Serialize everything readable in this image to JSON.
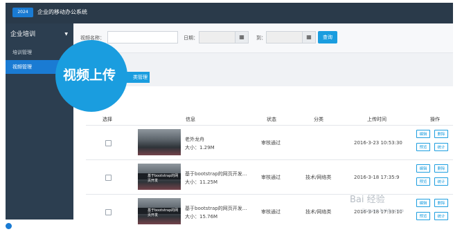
{
  "header": {
    "logo": "2024",
    "title": "企业的移动办公系统"
  },
  "sidebar": {
    "section": "企业培训",
    "items": [
      {
        "label": "培训管理"
      },
      {
        "label": "视频管理"
      }
    ]
  },
  "filter": {
    "name_label": "视频名称：",
    "date_label": "日期：",
    "to_label": "到：",
    "query": "查询"
  },
  "category_button": "类管理",
  "highlight": "视频上传",
  "table": {
    "headers": [
      "选择",
      "信息",
      "状态",
      "分类",
      "上传时间",
      "操作"
    ],
    "rows": [
      {
        "title": "老外龙舟",
        "size": "大小：1.29M",
        "caption": "",
        "status": "审核通过",
        "category": "",
        "time": "2016-3-23 10:53:30"
      },
      {
        "title": "基于bootstrap的网页开发...",
        "size": "大小：11.25M",
        "caption": "基于bootstrap的网页开发",
        "status": "审核通过",
        "category": "技术/网络类",
        "time": "2016-3-18 17:35:9"
      },
      {
        "title": "基于bootstrap的网页开发...",
        "size": "大小：15.76M",
        "caption": "基于bootstrap的网页开发",
        "status": "审核通过",
        "category": "技术/网络类",
        "time": "2016-3-18 17:33:10"
      }
    ],
    "actions": [
      "编辑",
      "删除",
      "预览",
      "统计"
    ]
  },
  "watermark": {
    "brand": "Bai 经验",
    "url": "jingyan.baidu.com"
  },
  "colors": {
    "accent": "#1a9ddf",
    "sidebar": "#2c3e50",
    "topbar": "#2a3a4a"
  }
}
